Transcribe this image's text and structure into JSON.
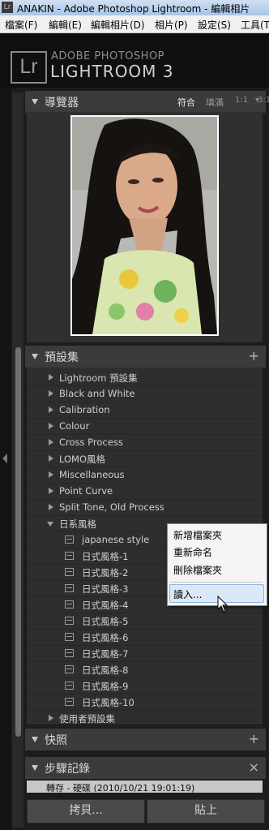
{
  "window": {
    "title": "ANAKIN - Adobe Photoshop Lightroom - 編輯相片"
  },
  "menu": [
    "檔案(F)",
    "編輯(E)",
    "編輯相片(D)",
    "相片(P)",
    "設定(S)",
    "工具(T"
  ],
  "brand": {
    "logo": "Lr",
    "line1": "ADOBE PHOTOSHOP",
    "line2": "LIGHTROOM 3"
  },
  "navigator": {
    "title": "導覽器",
    "options": [
      "符合",
      "填滿",
      "1:1",
      "3:1"
    ],
    "options_marker": "▾"
  },
  "presets": {
    "title": "預設集",
    "add_icon": "+",
    "folders_top": [
      "Lightroom 預設集",
      "Black and White",
      "Calibration",
      "Colour",
      "Cross Process",
      "LOMO風格",
      "Miscellaneous",
      "Point Curve",
      "Split Tone, Old Process"
    ],
    "open_folder": "日系風格",
    "items": [
      "japanese style",
      "日式風格-1",
      "日式風格-2",
      "日式風格-3",
      "日式風格-4",
      "日式風格-5",
      "日式風格-6",
      "日式風格-7",
      "日式風格-8",
      "日式風格-9",
      "日式風格-10"
    ],
    "folder_bottom": "使用者預設集"
  },
  "context_menu": [
    "新增檔案夾",
    "重新命名",
    "刪除檔案夾",
    "讀入..."
  ],
  "snapshots": {
    "title": "快照",
    "add_icon": "+"
  },
  "history": {
    "title": "步驟記錄",
    "close_icon": "×",
    "entry": "轉存 - 硬碟 (2010/10/21 19:01:19)"
  },
  "buttons": {
    "copy": "拷貝...",
    "paste": "貼上"
  },
  "colors": {
    "panel": "#3b3b3b",
    "background": "#1c1c1c",
    "highlight": "#dbe8f8"
  }
}
